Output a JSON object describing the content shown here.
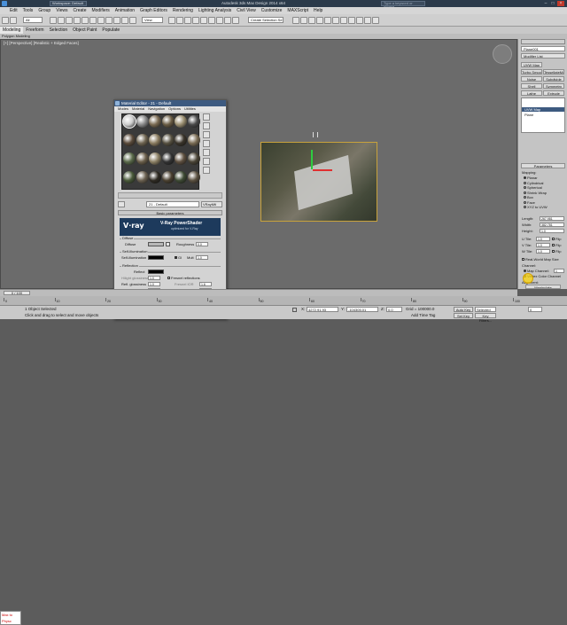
{
  "app": {
    "title": "Autodesk 3ds Max Design 2014 x64",
    "workspace": "Workspace: Default",
    "search_placeholder": "Type a keyword or phrase"
  },
  "menu": [
    "Edit",
    "Tools",
    "Group",
    "Views",
    "Create",
    "Modifiers",
    "Animation",
    "Graph Editors",
    "Rendering",
    "Lighting Analysis",
    "Civil View",
    "Customize",
    "MAXScript",
    "Help"
  ],
  "toolbar": {
    "filter": "All",
    "view_dropdown": "View",
    "selection_set": "Create Selection Se"
  },
  "ribbon": {
    "tabs": [
      "Modeling",
      "Freeform",
      "Selection",
      "Object Paint",
      "Populate"
    ],
    "sub": "Polygon Modeling"
  },
  "viewport": {
    "label": "[+] [Perspective] [Realistic + Edged Faces]"
  },
  "material_editor": {
    "title": "Material Editor - 21 - Default",
    "menu": [
      "Modes",
      "Material",
      "Navigation",
      "Options",
      "Utilities"
    ],
    "slot_colors": [
      "#cfcfcf",
      "#8a8a8a",
      "#7a6a52",
      "#6a5c44",
      "#9a8e70",
      "#4a4a4a",
      "#5a4a3a",
      "#6e6450",
      "#8a7c60",
      "#565040",
      "#3a342a",
      "#7a6c54",
      "#5a6a4a",
      "#6a5e4a",
      "#8c8064",
      "#333333",
      "#5e5040",
      "#4a4436",
      "#4a5a3a",
      "#6a6050",
      "#2e2a22",
      "#4a4030",
      "#3e4a34",
      "#5a5040"
    ],
    "mat_name": "21 - Default",
    "mat_type": "VRayMtl",
    "rollout_basic": "Basic parameters",
    "vray": {
      "logo": "V·ray",
      "title": "V-Ray PowerShader",
      "subtitle": "optimized for V-Ray"
    },
    "diffuse_group": "Diffuse",
    "diffuse_label": "Diffuse",
    "roughness_label": "Roughness",
    "roughness_value": "0.0",
    "selfillum_group": "Self-Illumination",
    "selfillum_label": "Self-illumination",
    "gi_label": "GI",
    "mult_label": "Mult",
    "mult_value": "1.0",
    "reflection_group": "Reflection",
    "reflect_label": "Reflect",
    "hilight_gloss_label": "Hilight glossiness",
    "hilight_gloss_value": "1.0",
    "fresnel_label": "Fresnel reflections",
    "refl_gloss_label": "Refl. glossiness",
    "refl_gloss_value": "1.0",
    "fresnel_ior_label": "Fresnel IOR",
    "fresnel_ior_value": "1.6",
    "subdivs_label": "Subdivs",
    "subdivs_value": "8",
    "max_depth_label": "Max depth",
    "max_depth_value": "5",
    "use_interp_label": "Use interpolation",
    "exit_color_label": "Exit color",
    "dim_distance_label": "Dim distance",
    "dim_distance_value": "100.0",
    "dim_falloff_label": "Dim fall off",
    "dim_falloff_value": "0.0",
    "affect_channels_label": "Affect channels",
    "affect_channels_value": "Color only",
    "refraction_group": "Refraction"
  },
  "command_panel": {
    "object_name": "Plane001",
    "modifier_list": "Modifier List",
    "buttons": [
      [
        "UVW Map",
        ""
      ],
      [
        "Turbo Smooth",
        "TessellateMod"
      ],
      [
        "Noise",
        "Subdivide"
      ],
      [
        "Shell",
        "Symmetry"
      ],
      [
        "Lathe",
        "Extrude"
      ]
    ],
    "stack": [
      "UVW Map",
      "Plane"
    ],
    "params_title": "Parameters",
    "mapping_label": "Mapping:",
    "mapping_options": [
      "Planar",
      "Cylindrical",
      "Spherical",
      "Shrink Wrap",
      "Box",
      "Face",
      "XYZ to UVW"
    ],
    "mapping_selected": 0,
    "length_label": "Length:",
    "length_value": "267.981",
    "width_label": "Width:",
    "width_value": "382.781",
    "height_label": "Height:",
    "height_value": "1.0",
    "utile_label": "U Tile:",
    "utile_value": "1.0",
    "vtile_label": "V Tile:",
    "vtile_value": "1.0",
    "wtile_label": "W Tile:",
    "wtile_value": "1.0",
    "flip_label": "Flip",
    "realworld_label": "Real-World Map Size",
    "channel_label": "Channel:",
    "map_channel_label": "Map Channel:",
    "map_channel_value": "1",
    "vertex_color_label": "Vertex Color Channel",
    "alignment_label": "Alignment:",
    "manipulate_label": "Manipulate"
  },
  "timeline": {
    "frame": "0 / 100",
    "ticks": [
      "0",
      "10",
      "20",
      "30",
      "40",
      "50",
      "60",
      "70",
      "80",
      "90",
      "100"
    ]
  },
  "status": {
    "script_text": "Max to Physc",
    "selected": "1 Object Selected",
    "prompt": "Click and drag to select and move objects",
    "x_label": "X:",
    "x_value": "4272.91.93",
    "y_label": "Y:",
    "y_value": "-104305.01",
    "z_label": "Z:",
    "z_value": "0.0",
    "grid": "Grid = 100000.0",
    "autokey": "Auto Key",
    "selected_dd": "Selected",
    "setkey": "Set Key",
    "keyfilters": "Key Filters...",
    "addtimetag": "Add Time Tag",
    "frame_field": "0"
  },
  "colors": {
    "accent_blue": "#3d5a80",
    "vray_banner": "#1d3a5c",
    "selection_yellow": "#c8a23c"
  }
}
